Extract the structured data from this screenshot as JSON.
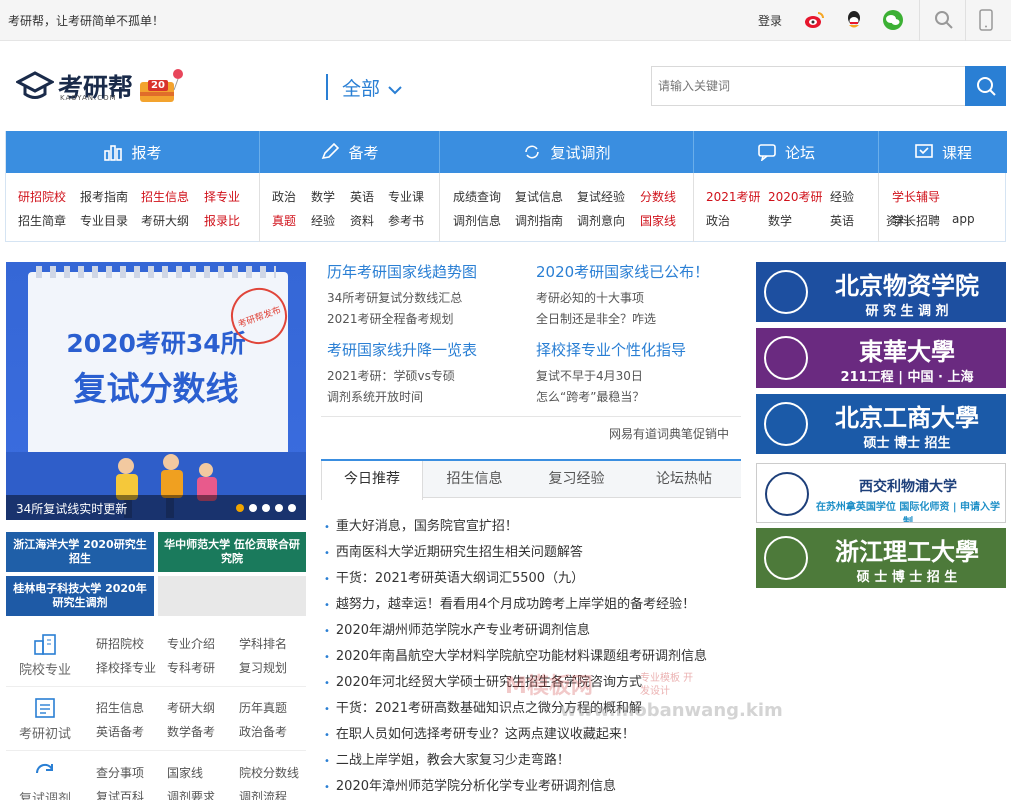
{
  "topbar": {
    "slogan": "考研帮，让考研简单不孤单！",
    "login": "登录"
  },
  "header": {
    "logo_text": "考研帮",
    "logo_domain": "KAOYAN.COM",
    "logo_badge": "20",
    "category": "全部",
    "search_placeholder": "请输入关键词"
  },
  "nav": [
    {
      "title": "报考",
      "icon": "chart-icon",
      "rows": [
        [
          {
            "t": "研招院校",
            "red": true
          },
          {
            "t": "报考指南"
          },
          {
            "t": "招生信息",
            "red": true
          },
          {
            "t": "择专业",
            "red": true
          }
        ],
        [
          {
            "t": "招生简章"
          },
          {
            "t": "专业目录"
          },
          {
            "t": "考研大纲"
          },
          {
            "t": "报录比",
            "red": true
          }
        ]
      ]
    },
    {
      "title": "备考",
      "icon": "pen-icon",
      "rows": [
        [
          {
            "t": "政治"
          },
          {
            "t": "数学"
          },
          {
            "t": "英语"
          },
          {
            "t": "专业课"
          }
        ],
        [
          {
            "t": "真题",
            "red": true
          },
          {
            "t": "经验"
          },
          {
            "t": "资料"
          },
          {
            "t": "参考书"
          }
        ]
      ]
    },
    {
      "title": "复试调剂",
      "icon": "refresh-icon",
      "rows": [
        [
          {
            "t": "成绩查询"
          },
          {
            "t": "复试信息"
          },
          {
            "t": "复试经验"
          },
          {
            "t": "分数线",
            "red": true
          }
        ],
        [
          {
            "t": "调剂信息"
          },
          {
            "t": "调剂指南"
          },
          {
            "t": "调剂意向"
          },
          {
            "t": "国家线",
            "red": true
          }
        ]
      ]
    },
    {
      "title": "论坛",
      "icon": "chat-icon",
      "rows": [
        [
          {
            "t": "2021考研",
            "red": true
          },
          {
            "t": "2020考研",
            "red": true
          },
          {
            "t": "经验"
          }
        ],
        [
          {
            "t": "政治"
          },
          {
            "t": "数学"
          },
          {
            "t": "英语"
          },
          {
            "t": "资料"
          }
        ]
      ]
    },
    {
      "title": "课程",
      "icon": "course-icon",
      "rows": [
        [
          {
            "t": "学长辅导",
            "red": true
          }
        ],
        [
          {
            "t": "学长招聘"
          },
          {
            "t": "app"
          }
        ]
      ]
    }
  ],
  "banner": {
    "line1": "2020考研34所",
    "line2": "复试分数线",
    "stamp": "考研帮发布",
    "caption": "34所复试线实时更新"
  },
  "mini_ads": [
    {
      "text": "浙江海洋大学 2020研究生招生",
      "color": "#1f5fa8"
    },
    {
      "text": "华中师范大学 伍伦贡联合研究院",
      "color": "#1a7a5c"
    },
    {
      "text": "桂林电子科技大学 2020年研究生调剂",
      "color": "#1e5aa6"
    }
  ],
  "left_categories": [
    {
      "label": "院校专业",
      "icon": "building-icon",
      "links": [
        [
          "研招院校",
          "专业介绍",
          "学科排名"
        ],
        [
          "择校择专业",
          "专科考研",
          "复习规划"
        ]
      ]
    },
    {
      "label": "考研初试",
      "icon": "document-icon",
      "links": [
        [
          "招生信息",
          "考研大纲",
          "历年真题"
        ],
        [
          "英语备考",
          "数学备考",
          "政治备考"
        ]
      ]
    },
    {
      "label": "复试调剂",
      "icon": "refresh-icon",
      "links": [
        [
          "查分事项",
          "国家线",
          "院校分数线"
        ],
        [
          "复试百科",
          "调剂要求",
          "调剂流程"
        ]
      ]
    }
  ],
  "middle": {
    "blocks": [
      {
        "head": "历年考研国家线趋势图",
        "items": [
          "34所考研复试分数线汇总",
          "2021考研全程备考规划"
        ]
      },
      {
        "head": "2020考研国家线已公布！",
        "items": [
          "考研必知的十大事项",
          "全日制还是非全？咋选"
        ]
      },
      {
        "head": "考研国家线升降一览表",
        "items": [
          "2021考研：学硕vs专硕",
          "调剂系统开放时间"
        ]
      },
      {
        "head": "择校择专业个性化指导",
        "items": [
          "复试不早于4月30日",
          "怎么“跨考”最稳当？"
        ]
      }
    ],
    "promo": "网易有道词典笔促销中",
    "tabs": [
      "今日推荐",
      "招生信息",
      "复习经验",
      "论坛热帖"
    ],
    "news": [
      "重大好消息，国务院官宣扩招！",
      "西南医科大学近期研究生招生相关问题解答",
      "干货：2021考研英语大纲词汇5500（九）",
      "越努力，越幸运！看看用4个月成功跨考上岸学姐的备考经验！",
      "2020年湖州师范学院水产专业考研调剂信息",
      "2020年南昌航空大学材料学院航空功能材料课题组考研调剂信息",
      "2020年河北经贸大学硕士研究生招生各学院咨询方式",
      "干货：2021考研高数基础知识点之微分方程的概和解",
      "在职人员如何选择考研专业？这两点建议收藏起来！",
      "二战上岸学姐，教会大家复习少走弯路！",
      "2020年漳州师范学院分析化学专业考研调剂信息"
    ]
  },
  "right_ads": [
    {
      "name": "北京物资学院",
      "sub": "研 究 生 调 剂",
      "bg": "#1d4fa0"
    },
    {
      "name": "東華大學",
      "sub": "211工程 | 中国 · 上海",
      "bg": "#6a2a80"
    },
    {
      "name": "北京工商大學",
      "sub": "硕士  博士  招生",
      "bg": "#1b5aa8"
    },
    {
      "name": "西交利物浦大学",
      "sub": "在苏州拿英国学位 国际化师资 | 申请入学制",
      "bg": "#ffffff"
    },
    {
      "name": "浙江理工大學",
      "sub": "硕 士  博 士  招 生",
      "bg": "#4d7a3a"
    }
  ],
  "watermark": {
    "line1": "M模板网",
    "line2": "www.mobanwang.kim",
    "tag": "专业模板 开发设计"
  }
}
